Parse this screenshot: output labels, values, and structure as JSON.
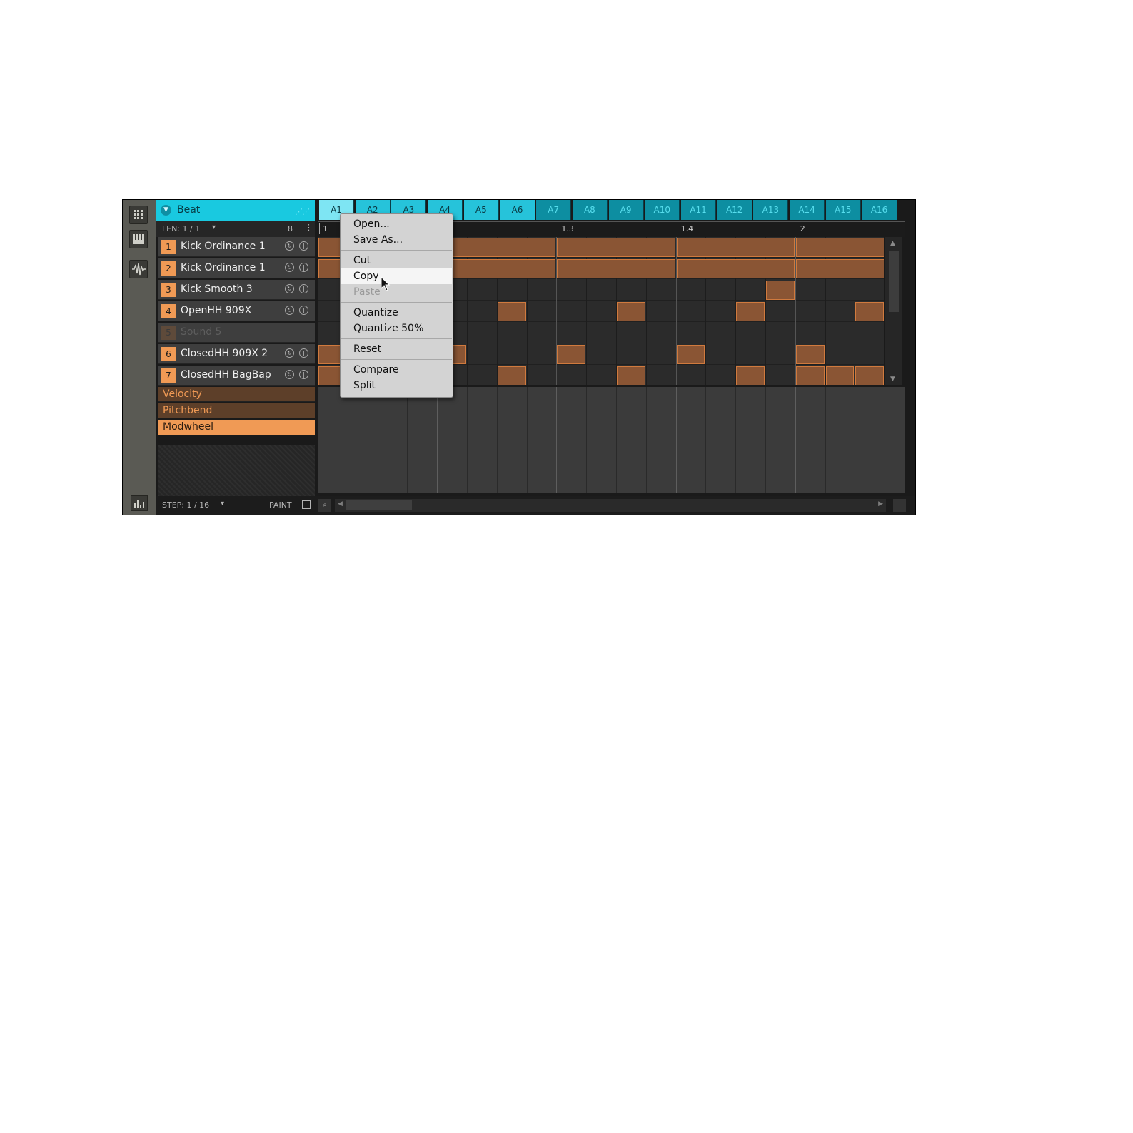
{
  "group": {
    "name": "Beat"
  },
  "patterns": [
    {
      "label": "A1",
      "state": "sel"
    },
    {
      "label": "A2",
      "state": "light"
    },
    {
      "label": "A3",
      "state": "light"
    },
    {
      "label": "A4",
      "state": "light"
    },
    {
      "label": "A5",
      "state": "light"
    },
    {
      "label": "A6",
      "state": "light"
    },
    {
      "label": "A7",
      "state": "dark"
    },
    {
      "label": "A8",
      "state": "dark"
    },
    {
      "label": "A9",
      "state": "dark"
    },
    {
      "label": "A10",
      "state": "dark"
    },
    {
      "label": "A11",
      "state": "dark"
    },
    {
      "label": "A12",
      "state": "dark"
    },
    {
      "label": "A13",
      "state": "dark"
    },
    {
      "label": "A14",
      "state": "dark"
    },
    {
      "label": "A15",
      "state": "dark"
    },
    {
      "label": "A16",
      "state": "dark"
    }
  ],
  "lenbar": {
    "len": "LEN: 1 / 1",
    "num": "8"
  },
  "ruler": [
    "1",
    "1.3",
    "1.4",
    "2"
  ],
  "sounds": [
    {
      "num": "1",
      "name": "Kick Ordinance 1",
      "dim": false
    },
    {
      "num": "2",
      "name": "Kick Ordinance 1",
      "dim": false
    },
    {
      "num": "3",
      "name": "Kick Smooth 3",
      "dim": false
    },
    {
      "num": "4",
      "name": "OpenHH 909X",
      "dim": false
    },
    {
      "num": "5",
      "name": "Sound 5",
      "dim": true
    },
    {
      "num": "6",
      "name": "ClosedHH 909X 2",
      "dim": false
    },
    {
      "num": "7",
      "name": "ClosedHH BagBap",
      "dim": false
    }
  ],
  "lanes": [
    {
      "label": "Velocity",
      "active": false
    },
    {
      "label": "Pitchbend",
      "active": false
    },
    {
      "label": "Modwheel",
      "active": true
    }
  ],
  "grid": {
    "steps": 19,
    "notes": [
      {
        "row": 0,
        "start": 0,
        "len": 8
      },
      {
        "row": 0,
        "start": 8,
        "len": 4
      },
      {
        "row": 0,
        "start": 12,
        "len": 4
      },
      {
        "row": 0,
        "start": 16,
        "len": 4
      },
      {
        "row": 1,
        "start": 0,
        "len": 8
      },
      {
        "row": 1,
        "start": 8,
        "len": 4
      },
      {
        "row": 1,
        "start": 12,
        "len": 4
      },
      {
        "row": 1,
        "start": 16,
        "len": 4
      },
      {
        "row": 2,
        "start": 15,
        "len": 1
      },
      {
        "row": 3,
        "start": 6,
        "len": 1
      },
      {
        "row": 3,
        "start": 10,
        "len": 1
      },
      {
        "row": 3,
        "start": 14,
        "len": 1
      },
      {
        "row": 3,
        "start": 18,
        "len": 1
      },
      {
        "row": 5,
        "start": 0,
        "len": 1
      },
      {
        "row": 5,
        "start": 4,
        "len": 1
      },
      {
        "row": 5,
        "start": 8,
        "len": 1
      },
      {
        "row": 5,
        "start": 12,
        "len": 1
      },
      {
        "row": 5,
        "start": 16,
        "len": 1
      },
      {
        "row": 6,
        "start": 0,
        "len": 1
      },
      {
        "row": 6,
        "start": 6,
        "len": 1
      },
      {
        "row": 6,
        "start": 10,
        "len": 1
      },
      {
        "row": 6,
        "start": 14,
        "len": 1
      },
      {
        "row": 6,
        "start": 16,
        "len": 1
      },
      {
        "row": 6,
        "start": 17,
        "len": 1
      },
      {
        "row": 6,
        "start": 18,
        "len": 1
      }
    ]
  },
  "bottom": {
    "step": "STEP: 1 / 16",
    "paint": "PAINT"
  },
  "menu": [
    {
      "label": "Open...",
      "state": "normal"
    },
    {
      "label": "Save As...",
      "state": "normal"
    },
    {
      "sep": true
    },
    {
      "label": "Cut",
      "state": "normal"
    },
    {
      "label": "Copy",
      "state": "highlighted"
    },
    {
      "label": "Paste",
      "state": "disabled"
    },
    {
      "sep": true
    },
    {
      "label": "Quantize",
      "state": "normal"
    },
    {
      "label": "Quantize 50%",
      "state": "normal"
    },
    {
      "sep": true
    },
    {
      "label": "Reset",
      "state": "normal"
    },
    {
      "sep": true
    },
    {
      "label": "Compare",
      "state": "normal"
    },
    {
      "label": "Split",
      "state": "normal"
    }
  ],
  "icons": {
    "step_grid": "grid-icon",
    "keyboard": "piano-keys-icon",
    "sample": "waveform-icon",
    "stats": "bars-chart-icon"
  }
}
